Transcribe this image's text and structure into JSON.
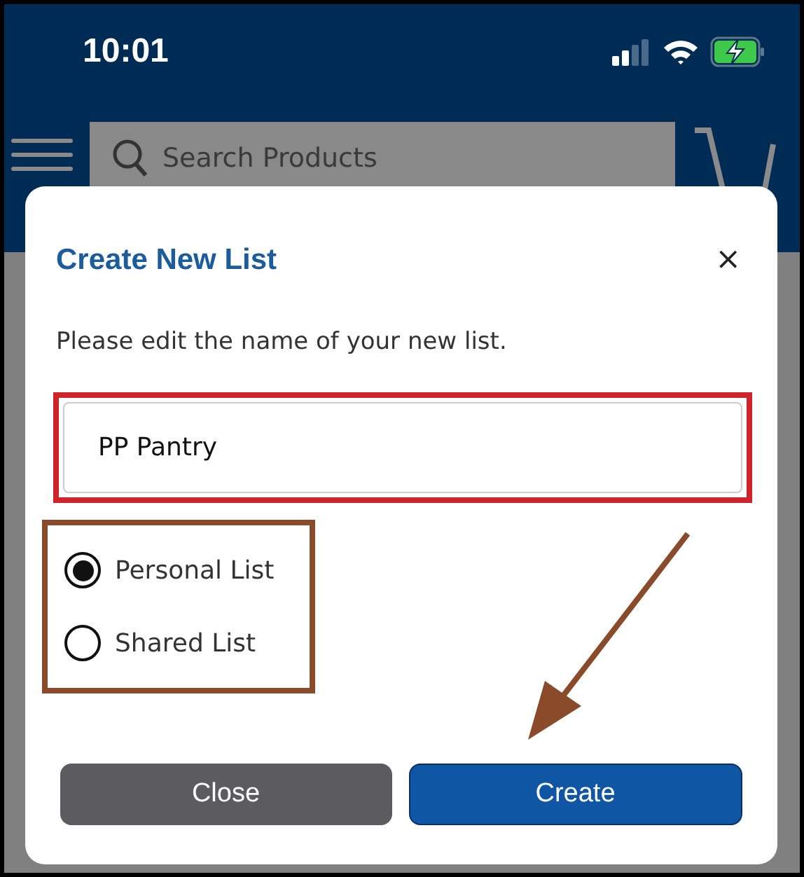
{
  "status_bar": {
    "time": "10:01"
  },
  "header": {
    "search": {
      "placeholder": "Search Products"
    }
  },
  "dialog": {
    "title": "Create New List",
    "close_icon": "×",
    "prompt": "Please edit the name of your new list.",
    "name_field": {
      "value": "PP Pantry"
    },
    "list_types": [
      {
        "label": "Personal List",
        "selected": true
      },
      {
        "label": "Shared List",
        "selected": false
      }
    ],
    "buttons": [
      {
        "label": "Close",
        "kind": "secondary"
      },
      {
        "label": "Create",
        "kind": "primary"
      }
    ]
  }
}
